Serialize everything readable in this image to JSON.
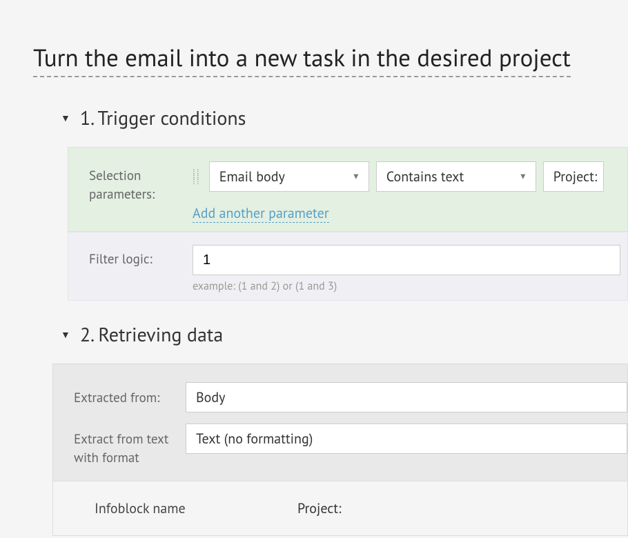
{
  "title": "Turn the email into a new task in the desired project",
  "section1": {
    "heading": "1. Trigger conditions",
    "paramsLabel": "Selection parameters:",
    "field": "Email body",
    "operator": "Contains text",
    "value": "Project:",
    "addLink": "Add another parameter",
    "filterLogicLabel": "Filter logic:",
    "filterLogicValue": "1",
    "filterLogicHint": "example: (1 and 2) or (1 and 3)"
  },
  "section2": {
    "heading": "2. Retrieving data",
    "extractedFromLabel": "Extracted from:",
    "extractedFromValue": "Body",
    "formatLabel": "Extract from text with format",
    "formatValue": "Text (no formatting)",
    "infoblockLabel": "Infoblock name",
    "infoblockValue": "Project:"
  }
}
